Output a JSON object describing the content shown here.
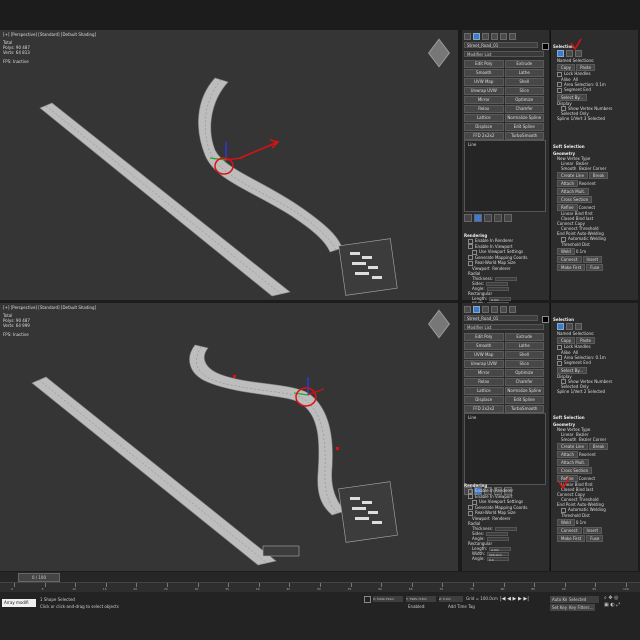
{
  "viewport_top": {
    "label": "[+] [Perspective] [Standard] [Default Shading]",
    "stats": {
      "title": "Total",
      "polys": "Polys:  90 487",
      "verts": "Verts:  64 813",
      "fps_label": "FPS:",
      "fps_value": "Inactive"
    }
  },
  "viewport_bottom": {
    "label": "[+] [Perspective] [Standard] [Default Shading]",
    "stats": {
      "title": "Total",
      "polys": "Polys:  90 487",
      "verts": "Verts:  64 999",
      "fps_label": "FPS:",
      "fps_value": "Inactive"
    }
  },
  "panel_top": {
    "object_name": "Street_Road_01",
    "modifier_list": "Modifier List",
    "modifier_buttons": [
      "Edit Poly",
      "Extrude",
      "Smooth",
      "Lathe",
      "UVW Map",
      "Shell",
      "Unwrap UVW",
      "Slice",
      "Mirror",
      "Optimize",
      "Relax",
      "Chamfer",
      "Lattice",
      "Normalize Spline",
      "Displace",
      "Edit Spline",
      "FFD 2x2x2",
      "TurboSmooth",
      "",
      "Noise"
    ],
    "stack_item": "Line",
    "rendering": {
      "title": "Rendering",
      "enable_renderer": "Enable In Renderer",
      "enable_viewport": "Enable In Viewport",
      "use_viewport": "Use Viewport Settings",
      "gen_mapping": "Generate Mapping Coords.",
      "real_world": "Real-World Map Size",
      "viewport": "Viewport",
      "renderer": "Renderer",
      "radial": "Radial",
      "thickness": "Thickness:",
      "sides": "Sides:",
      "angle": "Angle:",
      "rectangular": "Rectangular",
      "length": "Length:",
      "length_val": "0.0m",
      "width": "Width:",
      "width_val": "500.0cm",
      "angle2": "Angle:",
      "angle2_val": "0.0"
    }
  },
  "panel_bottom": {
    "object_name": "Street_Road_01",
    "modifier_list": "Modifier List",
    "modifier_buttons": [
      "Edit Poly",
      "Extrude",
      "Smooth",
      "Lathe",
      "UVW Map",
      "Shell",
      "Unwrap UVW",
      "Slice",
      "Mirror",
      "Optimize",
      "Relax",
      "Chamfer",
      "Lattice",
      "Normalize Spline",
      "Displace",
      "Edit Spline",
      "FFD 2x2x2",
      "TurboSmooth",
      "",
      "Noise"
    ],
    "stack_item": "Line",
    "rendering": {
      "title": "Rendering",
      "enable_renderer": "Enable In Renderer",
      "enable_viewport": "Enable In Viewport",
      "use_viewport": "Use Viewport Settings",
      "gen_mapping": "Generate Mapping Coords.",
      "real_world": "Real-World Map Size",
      "viewport": "Viewport",
      "renderer": "Renderer",
      "radial": "Radial",
      "thickness": "Thickness:",
      "sides": "Sides:",
      "angle": "Angle:",
      "rectangular": "Rectangular",
      "length": "Length:",
      "length_val": "0.0m",
      "width": "Width:",
      "width_val": "500.0cm",
      "angle2": "Angle:",
      "angle2_val": "0.0"
    }
  },
  "selection_top": {
    "title": "Selection",
    "named_sel": "Named Selections:",
    "copy": "Copy",
    "paste": "Paste",
    "lock_handles": "Lock Handles",
    "alike": "Alike",
    "all": "All",
    "area_sel": "Area Selection:",
    "area_val": "0.1m",
    "segment_end": "Segment End",
    "select_by": "Select By...",
    "display": "Display",
    "show_vertex": "Show Vertex Numbers",
    "selected_only": "Selected Only",
    "status": "Spline 1/Vert 3 Selected"
  },
  "selection_bottom": {
    "title": "Selection",
    "named_sel": "Named Selections:",
    "copy": "Copy",
    "paste": "Paste",
    "lock_handles": "Lock Handles",
    "alike": "Alike",
    "all": "All",
    "area_sel": "Area Selection:",
    "area_val": "0.1m",
    "segment_end": "Segment End",
    "select_by": "Select By...",
    "display": "Display",
    "show_vertex": "Show Vertex Numbers",
    "selected_only": "Selected Only",
    "status": "Spline 1/Vert 2 Selected"
  },
  "soft_sel_top": {
    "title": "Soft Selection"
  },
  "soft_sel_bottom": {
    "title": "Soft Selection"
  },
  "geometry_top": {
    "title": "Geometry",
    "new_vertex": "New Vertex Type",
    "linear": "Linear",
    "bezier": "Bezier",
    "smooth": "Smooth",
    "bezier_corner": "Bezier Corner",
    "create_line": "Create Line",
    "break": "Break",
    "attach": "Attach",
    "reorient": "Reorient",
    "attach_mult": "Attach Mult.",
    "cross_section": "Cross Section",
    "refine": "Refine",
    "connect": "Connect",
    "linear2": "Linear",
    "bind_first": "Bind first",
    "closed": "Closed",
    "bind_last": "Bind last",
    "connect_copy": "Connect Copy",
    "connect_label": "Connect",
    "threshold": "Threshold",
    "end_auto": "End Point Auto-Welding",
    "auto_weld": "Automatic Welding",
    "threshold_dist": "Threshold Dist",
    "weld": "Weld",
    "weld_val": "0.1m",
    "connect_btn": "Connect",
    "insert": "Insert",
    "make_first": "Make First",
    "fuse": "Fuse"
  },
  "geometry_bottom": {
    "title": "Geometry",
    "new_vertex": "New Vertex Type",
    "linear": "Linear",
    "bezier": "Bezier",
    "smooth": "Smooth",
    "bezier_corner": "Bezier Corner",
    "create_line": "Create Line",
    "break": "Break",
    "attach": "Attach",
    "reorient": "Reorient",
    "attach_mult": "Attach Mult.",
    "cross_section": "Cross Section",
    "refine": "Refine",
    "connect": "Connect",
    "linear2": "Linear",
    "bind_first": "Bind first",
    "closed": "Closed",
    "bind_last": "Bind last",
    "connect_copy": "Connect Copy",
    "connect_label": "Connect",
    "threshold": "Threshold",
    "end_auto": "End Point Auto-Welding",
    "auto_weld": "Automatic Welding",
    "threshold_dist": "Threshold Dist",
    "weld": "Weld",
    "weld_val": "0.1m",
    "connect_btn": "Connect",
    "insert": "Insert",
    "make_first": "Make First",
    "fuse": "Fuse"
  },
  "timeline": {
    "frame": "0 / 100",
    "ticks": [
      "0",
      "5",
      "10",
      "15",
      "20",
      "25",
      "30",
      "35",
      "40",
      "45",
      "50",
      "55",
      "60",
      "65",
      "70",
      "75",
      "80",
      "85",
      "90",
      "95",
      "100"
    ]
  },
  "status": {
    "script": "Array modifi",
    "shapes": "1 Shape Selected",
    "prompt": "Click or click-and-drag to select objects",
    "x": "X: 5444.791m",
    "y": "Y: 7965.718m",
    "z": "Z: 0.0m",
    "grid": "Grid = 100.0cm",
    "enabled": "Enabled:",
    "add_time_tag": "Add Time Tag",
    "auto_key": "Auto Key",
    "selected": "Selected",
    "set_key": "Set Key",
    "key_filters": "Key Filters..."
  },
  "colors": {
    "selection_red": "#e01010",
    "gizmo_blue": "#2a3aff",
    "gizmo_green": "#22aa22",
    "road": "#bdbdbd"
  }
}
